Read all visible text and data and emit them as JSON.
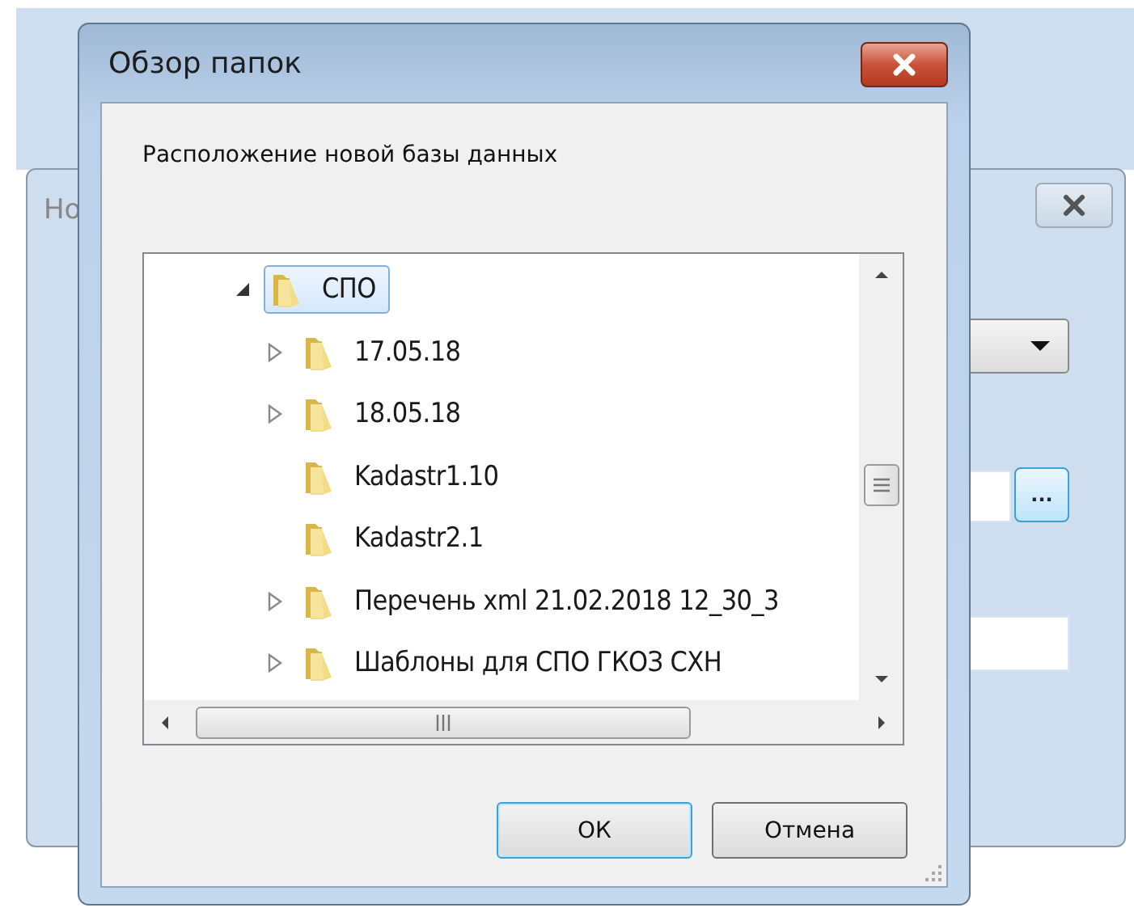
{
  "background_window": {
    "title": "Но",
    "browse_button": "..."
  },
  "dialog": {
    "title": "Обзор папок",
    "prompt": "Расположение новой базы данных",
    "tree": [
      {
        "label": "СПО",
        "expandable": true,
        "expanded": true,
        "selected": true,
        "children": [
          {
            "label": "17.05.18",
            "expandable": true,
            "expanded": false,
            "selected": false
          },
          {
            "label": "18.05.18",
            "expandable": true,
            "expanded": false,
            "selected": false
          },
          {
            "label": "Kadastr1.10",
            "expandable": false,
            "selected": false
          },
          {
            "label": "Kadastr2.1",
            "expandable": false,
            "selected": false
          },
          {
            "label": "Перечень xml 21.02.2018 12_30_3",
            "expandable": true,
            "expanded": false,
            "selected": false
          },
          {
            "label": "Шаблоны для СПО ГКОЗ СХН",
            "expandable": true,
            "expanded": false,
            "selected": false
          }
        ]
      }
    ],
    "buttons": [
      {
        "label": "ОК",
        "default": true
      },
      {
        "label": "Отмена",
        "default": false
      }
    ]
  }
}
